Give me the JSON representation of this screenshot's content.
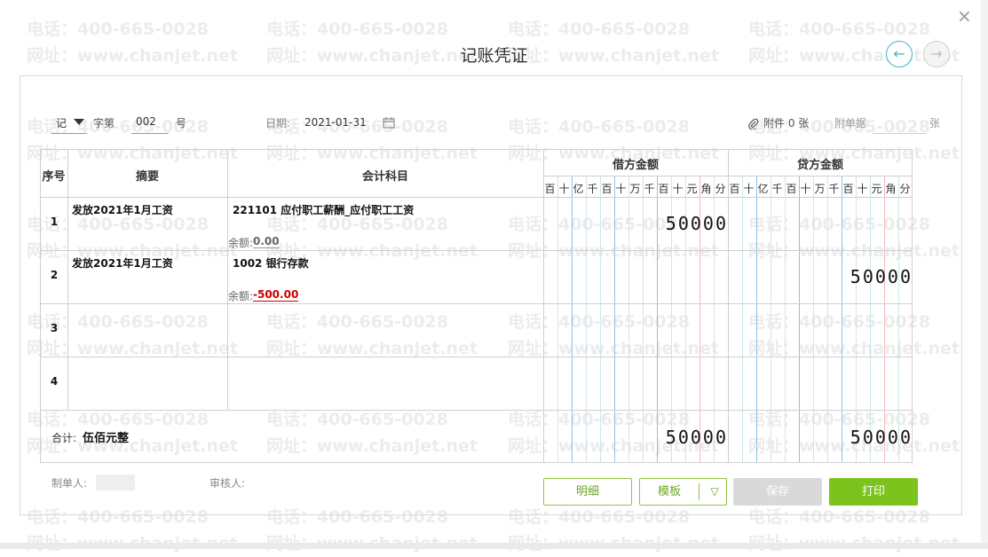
{
  "dialog": {
    "title": "记账凭证",
    "close_glyph": "×",
    "prev_glyph": "←",
    "next_glyph": "→"
  },
  "watermark": {
    "phone": "电话：400-665-0028",
    "site": "网址：www.chanjet.net"
  },
  "header": {
    "voucher_type": "记",
    "number_prefix": "字第",
    "number": "002",
    "number_suffix": "号",
    "date_label": "日期:",
    "date": "2021-01-31",
    "attachment": "附件 0 张",
    "attach_doc_label": "附单据",
    "attach_doc_unit": "张"
  },
  "table": {
    "col_seq": "序号",
    "col_summary": "摘要",
    "col_account": "会计科目",
    "col_debit": "借方金额",
    "col_credit": "贷方金额",
    "units": [
      "百",
      "十",
      "亿",
      "千",
      "百",
      "十",
      "万",
      "千",
      "百",
      "十",
      "元",
      "角",
      "分"
    ],
    "rows": [
      {
        "no": "1",
        "summary": "发放2021年1月工资",
        "account": "221101 应付职工薪酬_应付职工工资",
        "balance_label": "余额:",
        "balance": "0.00",
        "debit": "50000",
        "credit": ""
      },
      {
        "no": "2",
        "summary": "发放2021年1月工资",
        "account": "1002 银行存款",
        "balance_label": "余额:",
        "balance": "-500.00",
        "debit": "",
        "credit": "50000"
      },
      {
        "no": "3",
        "summary": "",
        "account": "",
        "balance_label": "",
        "balance": "",
        "debit": "",
        "credit": ""
      },
      {
        "no": "4",
        "summary": "",
        "account": "",
        "balance_label": "",
        "balance": "",
        "debit": "",
        "credit": ""
      }
    ],
    "total_label": "合计:",
    "total_words": "伍佰元整",
    "total_debit": "50000",
    "total_credit": "50000"
  },
  "footer": {
    "maker_label": "制单人:",
    "reviewer_label": "审核人:"
  },
  "buttons": {
    "detail": "明细",
    "template": "模板",
    "template_arrow": "▽",
    "save": "保存",
    "print": "打印"
  },
  "colors": {
    "accent_green": "#7cc41d",
    "nav_blue": "#3fb4c9",
    "negative_red": "#cc0000"
  }
}
